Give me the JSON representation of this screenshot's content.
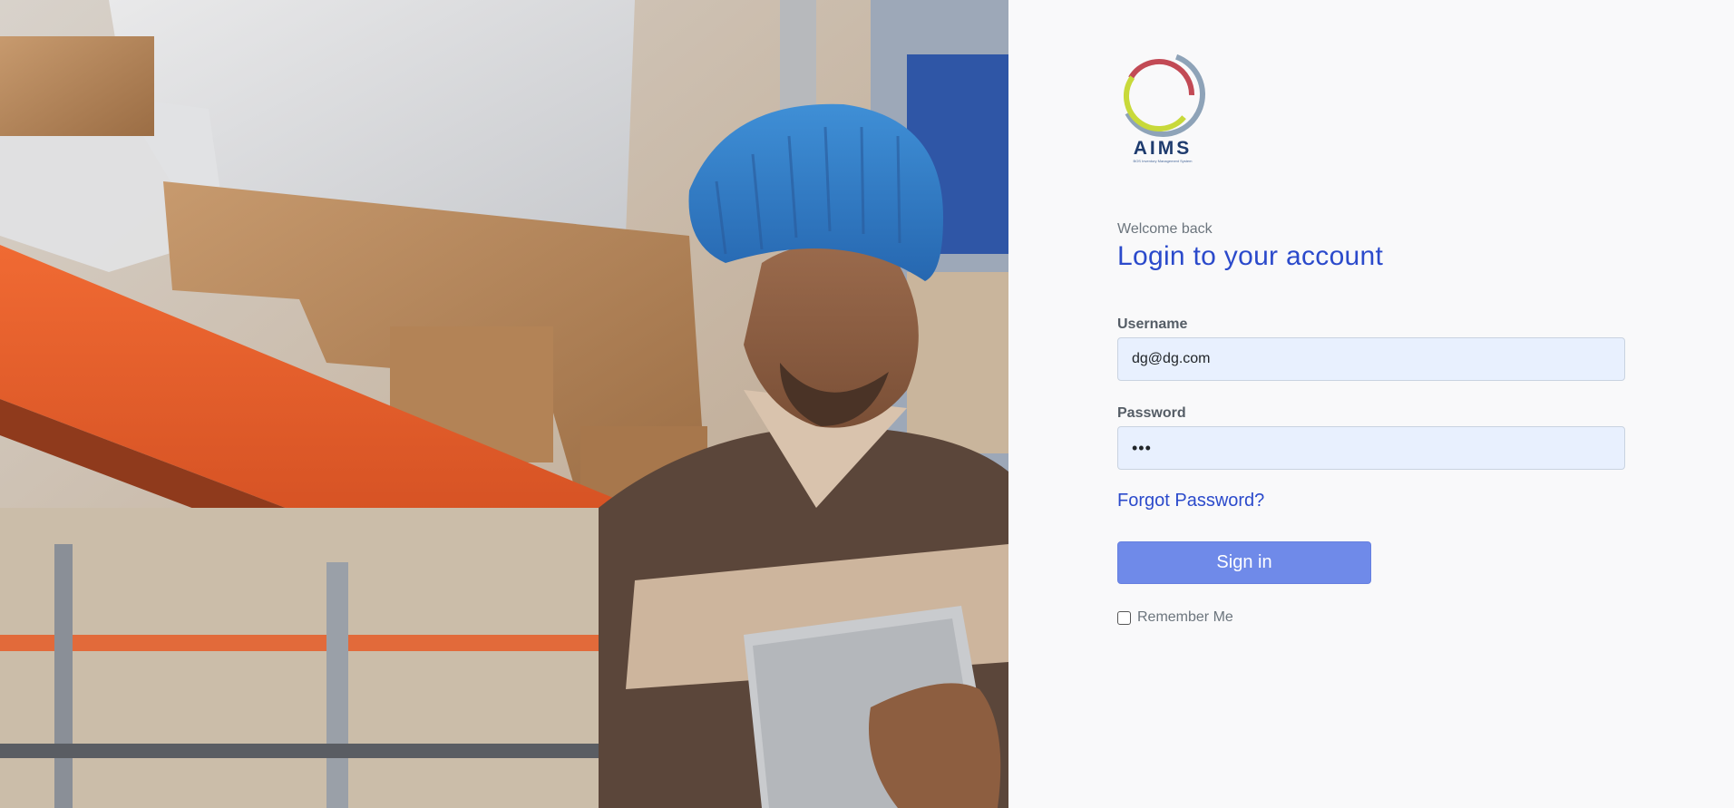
{
  "brand": {
    "name": "AIMS",
    "tagline": "BOS Inventory Management System",
    "colors": {
      "ring_red": "#c24a55",
      "ring_yellow": "#c8d93a",
      "ring_gray": "#8ea3b8",
      "navy": "#1e3b6e"
    }
  },
  "hero_image": {
    "alt": "warehouse worker with tablet",
    "icon": "photo"
  },
  "login": {
    "welcome": "Welcome back",
    "title": "Login to your account",
    "username_label": "Username",
    "username_value": "dg@dg.com",
    "password_label": "Password",
    "password_value": "•••",
    "forgot_label": "Forgot Password?",
    "signin_label": "Sign in",
    "remember_label": "Remember Me",
    "remember_checked": false
  },
  "colors": {
    "accent": "#2b4acb",
    "button": "#6f8ae9",
    "input_bg": "#e8f0fe",
    "page_bg": "#f9f9fa"
  }
}
